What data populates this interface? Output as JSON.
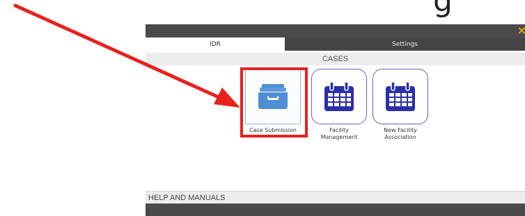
{
  "page": {
    "top_partial_text": "g"
  },
  "window": {
    "close_glyph": "×"
  },
  "tabs": [
    {
      "label": "IDR",
      "active": true
    },
    {
      "label": "Settings",
      "active": false
    }
  ],
  "cases_section": {
    "title": "CASES",
    "tiles": [
      {
        "label": "Case Submission",
        "icon": "file-drawer-icon"
      },
      {
        "label": "Facility\nManagement",
        "icon": "calendar-icon"
      },
      {
        "label": "New Facility\nAssociation",
        "icon": "calendar-icon"
      }
    ]
  },
  "help_section": {
    "title": "HELP AND MANUALS"
  },
  "colors": {
    "annotation_red": "#e8211c",
    "calendar_blue": "#2b2fa8",
    "drawer_blue": "#4f8ed3",
    "header_dark": "#4a4a4a",
    "close_orange": "#f0a020"
  }
}
